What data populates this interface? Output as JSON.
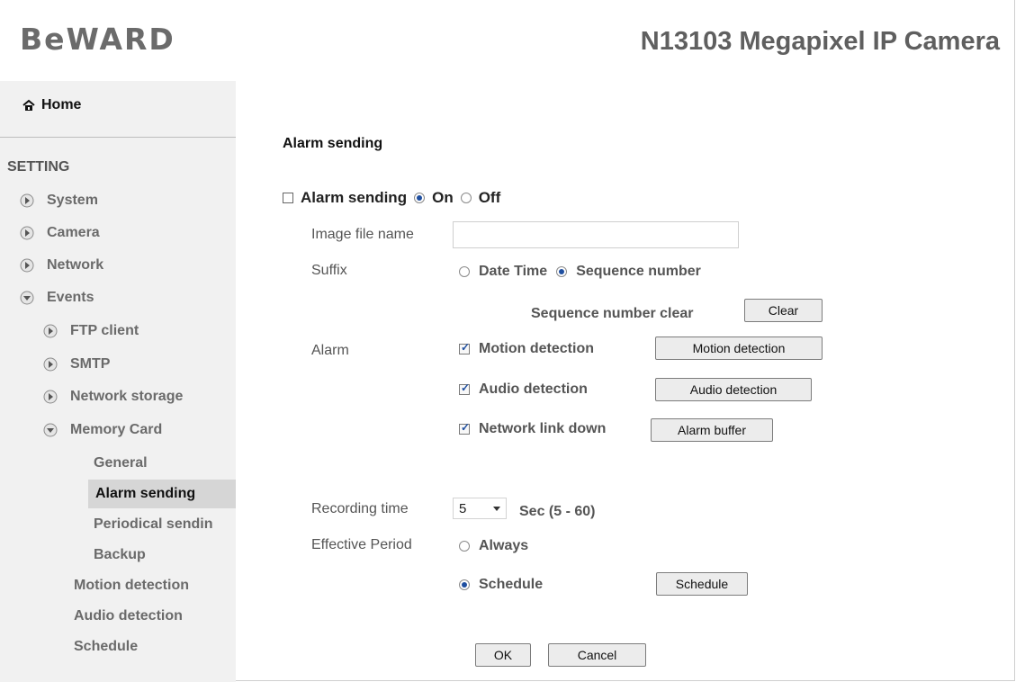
{
  "header": {
    "logo_text": "BeWARD",
    "product_title": "N13103 Megapixel IP Camera"
  },
  "sidebar": {
    "home_label": "Home",
    "setting_label": "SETTING",
    "items": [
      {
        "label": "System",
        "icon": "play-right-icon"
      },
      {
        "label": "Camera",
        "icon": "play-right-icon"
      },
      {
        "label": "Network",
        "icon": "play-right-icon"
      },
      {
        "label": "Events",
        "icon": "play-down-icon"
      }
    ],
    "events_items": [
      {
        "label": "FTP client",
        "icon": "play-right-icon"
      },
      {
        "label": "SMTP",
        "icon": "play-right-icon"
      },
      {
        "label": "Network storage",
        "icon": "play-right-icon"
      },
      {
        "label": "Memory Card",
        "icon": "play-down-icon"
      }
    ],
    "memory_card_items": [
      {
        "label": "General"
      },
      {
        "label": "Alarm sending",
        "active": true
      },
      {
        "label": "Periodical sendin"
      },
      {
        "label": "Backup"
      }
    ],
    "bottom_items": [
      {
        "label": "Motion detection"
      },
      {
        "label": "Audio detection"
      },
      {
        "label": "Schedule"
      }
    ]
  },
  "content": {
    "section_title": "Alarm sending",
    "alarm_sending_label": "Alarm sending",
    "on_label": "On",
    "off_label": "Off",
    "image_file_name_label": "Image file name",
    "image_file_name_value": "",
    "suffix_label": "Suffix",
    "date_time_label": "Date Time",
    "sequence_number_label": "Sequence number",
    "sequence_number_clear_label": "Sequence number clear",
    "clear_button": "Clear",
    "alarm_label": "Alarm",
    "motion_detection_check_label": "Motion detection",
    "motion_detection_button": "Motion detection",
    "audio_detection_check_label": "Audio detection",
    "audio_detection_button": "Audio detection",
    "network_link_down_label": "Network link down",
    "alarm_buffer_button": "Alarm buffer",
    "recording_time_label": "Recording time",
    "recording_time_value": "5",
    "recording_range_label": "Sec (5 - 60)",
    "effective_period_label": "Effective Period",
    "always_label": "Always",
    "schedule_label": "Schedule",
    "schedule_button": "Schedule",
    "ok_button": "OK",
    "cancel_button": "Cancel"
  }
}
